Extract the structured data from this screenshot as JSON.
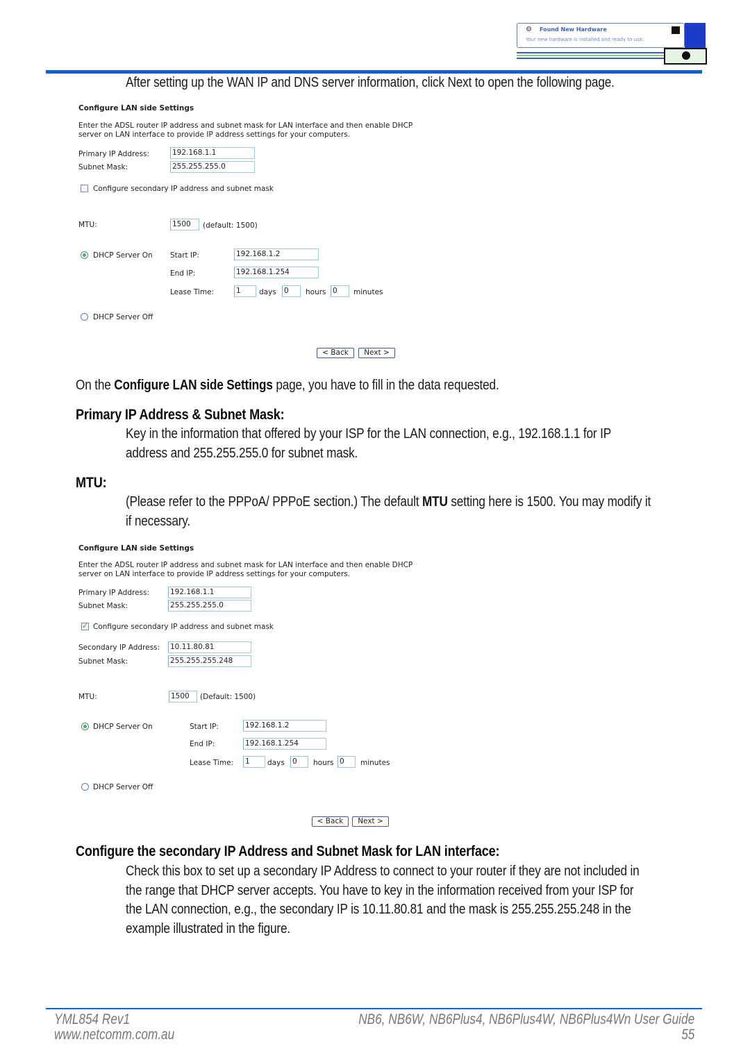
{
  "header": {
    "notification": {
      "title": "Found New Hardware",
      "message": "Your new hardware is installed and ready to use."
    }
  },
  "intro": "After setting up the WAN IP and DNS server information, click Next to open the following page.",
  "figure1": {
    "title": "Configure LAN side Settings",
    "description_line1": "Enter the ADSL router IP address and subnet mask for LAN interface and then enable DHCP",
    "description_line2": "server on LAN interface to provide IP address settings for your computers.",
    "primary_ip_label": "Primary IP Address:",
    "primary_ip_value": "192.168.1.1",
    "subnet_mask_label": "Subnet Mask:",
    "subnet_mask_value": "255.255.255.0",
    "secondary_checkbox_label": "Configure secondary IP address and subnet mask",
    "secondary_checked": false,
    "mtu_label": "MTU:",
    "mtu_value": "1500",
    "mtu_default": "(default: 1500)",
    "dhcp_on_label": "DHCP Server On",
    "dhcp_on_selected": true,
    "start_ip_label": "Start IP:",
    "start_ip_value": "192.168.1.2",
    "end_ip_label": "End IP:",
    "end_ip_value": "192.168.1.254",
    "lease_time_label": "Lease Time:",
    "lease_days_value": "1",
    "days_label": "days",
    "lease_hours_value": "0",
    "hours_label": "hours",
    "lease_minutes_value": "0",
    "minutes_label": "minutes",
    "dhcp_off_label": "DHCP Server Off",
    "back_label": "< Back",
    "next_label": "Next >"
  },
  "para_configure": {
    "pre": "On the ",
    "bold": "Configure LAN side Settings",
    "post": " page, you have to fill in the data requested."
  },
  "section_primary": {
    "heading": "Primary IP Address & Subnet Mask:",
    "line1": "Key in the information that offered by your ISP for the LAN connection, e.g., 192.168.1.1 for IP",
    "line2": "address and 255.255.255.0 for subnet mask."
  },
  "section_mtu": {
    "heading": "MTU:",
    "line1_pre": "(Please refer to the PPPoA/ PPPoE section.) The default ",
    "line1_bold": "MTU",
    "line1_post": " setting here is 1500. You may modify it",
    "line2": "if necessary."
  },
  "figure2": {
    "title": "Configure LAN side Settings",
    "description_line1": "Enter the ADSL router IP address and subnet mask for LAN interface and then enable DHCP",
    "description_line2": "server on LAN interface to provide IP address settings for your computers.",
    "primary_ip_label": "Primary IP Address:",
    "primary_ip_value": "192.168.1.1",
    "subnet_mask_label": "Subnet Mask:",
    "subnet_mask_value": "255.255.255.0",
    "secondary_checkbox_label": "Configure secondary IP address and subnet mask",
    "secondary_checked": true,
    "secondary_ip_label": "Secondary IP Address:",
    "secondary_ip_value": "10.11.80.81",
    "secondary_mask_label": "Subnet Mask:",
    "secondary_mask_value": "255.255.255.248",
    "mtu_label": "MTU:",
    "mtu_value": "1500",
    "mtu_default": "(Default: 1500)",
    "dhcp_on_label": "DHCP Server On",
    "dhcp_on_selected": true,
    "start_ip_label": "Start IP:",
    "start_ip_value": "192.168.1.2",
    "end_ip_label": "End IP:",
    "end_ip_value": "192.168.1.254",
    "lease_time_label": "Lease Time:",
    "lease_days_value": "1",
    "days_label": "days",
    "lease_hours_value": "0",
    "hours_label": "hours",
    "lease_minutes_value": "0",
    "minutes_label": "minutes",
    "dhcp_off_label": "DHCP Server Off",
    "back_label": "< Back",
    "next_label": "Next >"
  },
  "section_secondary": {
    "heading": "Configure the secondary IP Address and Subnet Mask for LAN interface:",
    "line1": "Check this box to set up a secondary IP Address to connect to your router if they are not included in",
    "line2": "the range that DHCP server accepts. You have to key in the information received from your ISP for",
    "line3": "the LAN connection, e.g., the secondary IP is 10.11.80.81 and the mask is 255.255.255.248 in the",
    "line4": "example illustrated in the figure."
  },
  "footer": {
    "doc_id": "YML854 Rev1",
    "website": "www.netcomm.com.au",
    "guide_title": "NB6, NB6W, NB6Plus4, NB6Plus4W, NB6Plus4Wn User Guide",
    "page_number": "55"
  },
  "colors": {
    "rule_blue": "#1560d0",
    "input_border": "#9cc8d8",
    "radio_green": "#3cbf3c"
  }
}
